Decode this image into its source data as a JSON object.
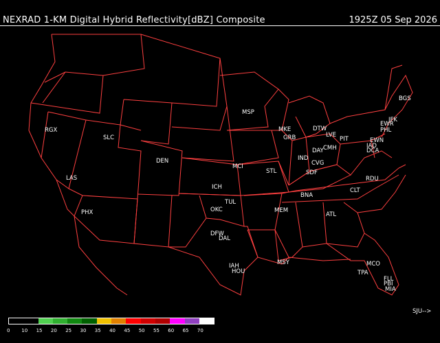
{
  "header": {
    "title": "NEXRAD 1-KM Digital Hybrid Reflectivity[dBZ] Composite",
    "timestamp": "1925Z 05 Sep 2026"
  },
  "colors": {
    "background": "#000000",
    "borders": "#ff4040",
    "text": "#ffffff"
  },
  "stations": [
    "RGX",
    "SLC",
    "DEN",
    "LAS",
    "PHX",
    "MSP",
    "MKE",
    "GRB",
    "DTW",
    "LVE",
    "BGS",
    "EWR",
    "PHL",
    "JFK",
    "EWN",
    "IAD",
    "DCA",
    "PIT",
    "DAY",
    "CMH",
    "IND",
    "CVG",
    "SDF",
    "STL",
    "MCI",
    "ICH",
    "TUL",
    "OKC",
    "DFW",
    "DAL",
    "BNA",
    "MEM",
    "CLT",
    "RDU",
    "ATL",
    "IAH",
    "HOU",
    "MSY",
    "MCO",
    "TPA",
    "FLL",
    "PBI",
    "MIA"
  ],
  "offmap": {
    "label": "SJU-->"
  },
  "legend": {
    "labels": [
      "0",
      "10",
      "15",
      "20",
      "25",
      "30",
      "35",
      "40",
      "45",
      "50",
      "55",
      "60",
      "65",
      "70"
    ],
    "colors": [
      "#000000",
      "#000000",
      "#50d050",
      "#30b030",
      "#108810",
      "#006000",
      "#f0c000",
      "#e08000",
      "#ff0000",
      "#d00000",
      "#b00000",
      "#ff00ff",
      "#9040c0",
      "#ffffff"
    ]
  }
}
